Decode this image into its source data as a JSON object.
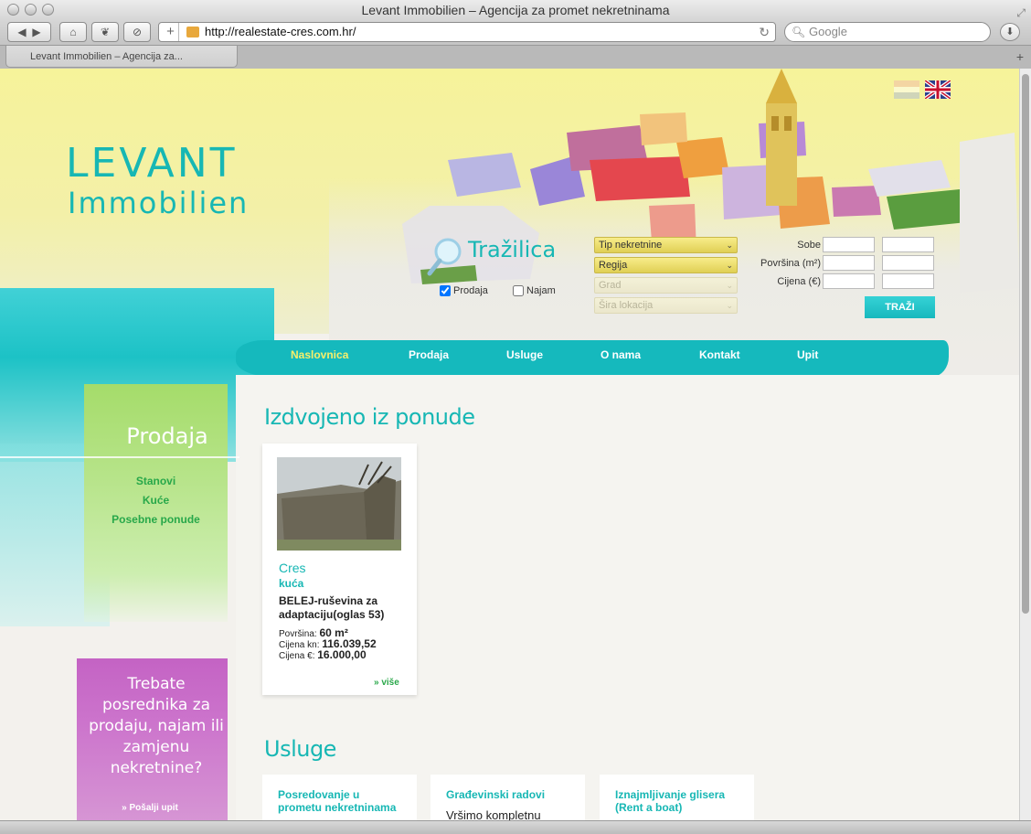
{
  "browser": {
    "window_title": "Levant Immobilien – Agencija za promet nekretninama",
    "url": "http://realestate-cres.com.hr/",
    "search_placeholder": "Google",
    "tab_title": "Levant Immobilien – Agencija za..."
  },
  "logo": {
    "line1": "LEVANT",
    "line2": "Immobilien"
  },
  "search_widget": {
    "title": "Tražilica",
    "checkbox_sale": {
      "label": "Prodaja",
      "checked": true
    },
    "checkbox_rent": {
      "label": "Najam",
      "checked": false
    },
    "selects": {
      "type": "Tip nekretnine",
      "region": "Regija",
      "city": "Grad",
      "location": "Šira lokacija"
    },
    "labels": {
      "rooms": "Sobe",
      "area": "Površina (m²)",
      "price": "Cijena (€)"
    },
    "button": "TRAŽI"
  },
  "nav": [
    "Naslovnica",
    "Prodaja",
    "Usluge",
    "O nama",
    "Kontakt",
    "Upit"
  ],
  "sidebar": {
    "title": "Prodaja",
    "links": [
      "Stanovi",
      "Kuće",
      "Posebne ponude"
    ],
    "promo_text": "Trebate posrednika za prodaju, najam ili zamjenu nekretnine?",
    "promo_link": "» Pošalji upit"
  },
  "featured": {
    "title": "Izdvojeno iz ponude",
    "card": {
      "town": "Cres",
      "type": "kuća",
      "name": "BELEJ-ruševina za adaptaciju(oglas 53)",
      "area_label": "Površina:",
      "area_value": "60 m²",
      "price_kn_label": "Cijena kn:",
      "price_kn_value": "116.039,52",
      "price_eur_label": "Cijena €:",
      "price_eur_value": "16.000,00",
      "more": "» više"
    }
  },
  "services": {
    "title": "Usluge",
    "items": [
      {
        "title": "Posredovanje u prometu nekretninama",
        "text": ""
      },
      {
        "title": "Građevinski radovi",
        "text": "Vršimo kompletnu"
      },
      {
        "title": "Iznajmljivanje glisera (Rent a boat)",
        "text": ""
      }
    ]
  },
  "colors": {
    "accent": "#17b7b4",
    "nav_active": "#f7ef6a",
    "link_green": "#28a84a",
    "promo_purple": "#c463c4"
  }
}
